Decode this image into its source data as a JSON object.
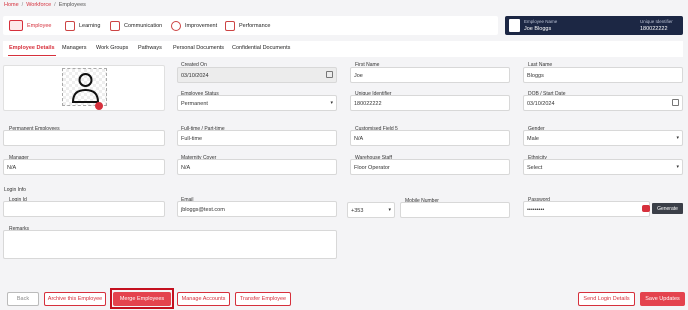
{
  "breadcrumb": {
    "home": "Home",
    "workforce": "Workforce",
    "current": "Employees",
    "sep": "/"
  },
  "topnav": {
    "employee": "Employee",
    "learning": "Learning",
    "communication": "Communication",
    "improvement": "Improvement",
    "performance": "Performance"
  },
  "employee_box": {
    "name_label": "Employee Name",
    "name": "Joe Bloggs",
    "id_label": "Unique Identifier",
    "id": "180022222"
  },
  "tabs": [
    "Employee Details",
    "Managers",
    "Work Groups",
    "Pathways",
    "Personal Documents",
    "Confidential Documents"
  ],
  "fields": {
    "created_on": {
      "label": "Created On",
      "value": "03/10/2024"
    },
    "first_name": {
      "label": "First Name",
      "value": "Joe"
    },
    "last_name": {
      "label": "Last Name",
      "value": "Bloggs"
    },
    "employee_status": {
      "label": "Employee Status",
      "value": "Permanent"
    },
    "unique_identifier": {
      "label": "Unique Identifier",
      "value": "180022222"
    },
    "dob": {
      "label": "DOB / Start Date",
      "value": "03/10/2024"
    },
    "permanent_employees": {
      "label": "Permanent Employees",
      "value": ""
    },
    "full_part_time": {
      "label": "Full-time / Part-time",
      "value": "Full-time"
    },
    "customised_field_5": {
      "label": "Customised Field 5",
      "value": "N/A"
    },
    "gender": {
      "label": "Gender",
      "value": "Male"
    },
    "manager": {
      "label": "Manager",
      "value": "N/A"
    },
    "maternity_cover": {
      "label": "Maternity Cover",
      "value": "N/A"
    },
    "warehouse_staff": {
      "label": "Warehouse Staff",
      "value": "Floor Operator"
    },
    "ethnicity": {
      "label": "Ethnicity",
      "value": "Select"
    },
    "login_id": {
      "label": "Login Id",
      "value": ""
    },
    "email": {
      "label": "Email",
      "value": "jbloggs@test.com"
    },
    "mobile_number": {
      "label": "Mobile Number",
      "prefix": "+353",
      "value": ""
    },
    "password": {
      "label": "Password",
      "value": "•••••••••"
    },
    "remarks": {
      "label": "Remarks",
      "value": ""
    }
  },
  "login_info_label": "Login Info",
  "generate_label": "Generate",
  "buttons": {
    "back": "Back",
    "archive": "Archive this Employee",
    "merge": "Merge Employees",
    "manage": "Manage Accounts",
    "transfer": "Transfer Employee",
    "send_login": "Send Login Details",
    "save": "Save Updates"
  },
  "colors": {
    "accent": "#d6303c",
    "header_dark": "#1c2744"
  },
  "icons": {
    "dropdown": "▾"
  }
}
